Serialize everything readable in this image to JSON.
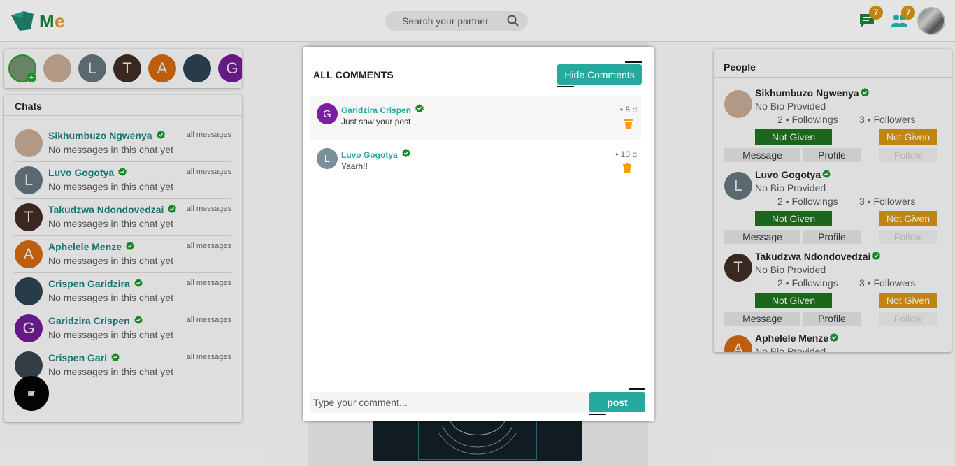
{
  "app": {
    "logo_text_m": "M",
    "logo_text_e": "e"
  },
  "search": {
    "placeholder": "Search your partner"
  },
  "topbar": {
    "messages_badge": "7",
    "people_badge": "7"
  },
  "stories": [
    {
      "initial": "",
      "color": "#6d8a6a",
      "add": true
    },
    {
      "initial": "",
      "color": "#b9a08b"
    },
    {
      "initial": "L",
      "color": "#5e6d75"
    },
    {
      "initial": "T",
      "color": "#3d2a22"
    },
    {
      "initial": "A",
      "color": "#c4620e"
    },
    {
      "initial": "",
      "color": "#2a3e4d"
    },
    {
      "initial": "G",
      "color": "#6a1b8a"
    }
  ],
  "chats": {
    "title": "Chats",
    "items": [
      {
        "name": "Sikhumbuzo Ngwenya",
        "message": "No messages in this chat yet",
        "all": "all messages",
        "initial": "",
        "color": "#b9a08b"
      },
      {
        "name": "Luvo Gogotya",
        "message": "No messages in this chat yet",
        "all": "all messages",
        "initial": "L",
        "color": "#5e6d75"
      },
      {
        "name": "Takudzwa Ndondovedzai",
        "message": "No messages in this chat yet",
        "all": "all messages",
        "initial": "T",
        "color": "#3d2a22"
      },
      {
        "name": "Aphelele Menze",
        "message": "No messages in this chat yet",
        "all": "all messages",
        "initial": "A",
        "color": "#c4620e"
      },
      {
        "name": "Crispen Garidzira",
        "message": "No messages in this chat yet",
        "all": "all messages",
        "initial": "",
        "color": "#2a3e4d"
      },
      {
        "name": "Garidzira Crispen",
        "message": "No messages in this chat yet",
        "all": "all messages",
        "initial": "G",
        "color": "#6a1b8a"
      },
      {
        "name": "Crispen Gari",
        "message": "No messages in this chat yet",
        "all": "all messages",
        "initial": "",
        "color": "#33404a"
      }
    ]
  },
  "people": {
    "title": "People",
    "items": [
      {
        "name": "Sikhumbuzo Ngwenya",
        "bio": "No Bio Provided",
        "followings": "2 • Followings",
        "followers": "3 • Followers",
        "not_given": "Not Given",
        "message": "Message",
        "profile": "Profile",
        "follow": "Follow",
        "initial": "",
        "color": "#b9a08b"
      },
      {
        "name": "Luvo Gogotya",
        "bio": "No Bio Provided",
        "followings": "2 • Followings",
        "followers": "3 • Followers",
        "not_given": "Not Given",
        "message": "Message",
        "profile": "Profile",
        "follow": "Follow",
        "initial": "L",
        "color": "#5e6d75"
      },
      {
        "name": "Takudzwa Ndondovedzai",
        "bio": "No Bio Provided",
        "followings": "2 • Followings",
        "followers": "3 • Followers",
        "not_given": "Not Given",
        "message": "Message",
        "profile": "Profile",
        "follow": "Follow",
        "initial": "T",
        "color": "#3d2a22"
      },
      {
        "name": "Aphelele Menze",
        "bio": "No Bio Provided",
        "followings": "",
        "followers": "",
        "not_given": "",
        "message": "",
        "profile": "",
        "follow": "",
        "initial": "A",
        "color": "#c4620e"
      }
    ]
  },
  "modal": {
    "title": "ALL COMMENTS",
    "hide_label": "Hide Comments",
    "comments": [
      {
        "name": "Garidzira Crispen",
        "text": "Just saw your post",
        "time": "• 8 d",
        "initial": "G",
        "color": "#7b1fa2"
      },
      {
        "name": "Luvo Gogotya",
        "text": "Yaarh!!",
        "time": "• 10 d",
        "initial": "L",
        "color": "#78909c"
      }
    ],
    "input_placeholder": "Type your comment...",
    "post_label": "post"
  },
  "colors": {
    "accent": "#26aaa0",
    "verified": "#1a8a2a",
    "trash": "#f5a000"
  }
}
